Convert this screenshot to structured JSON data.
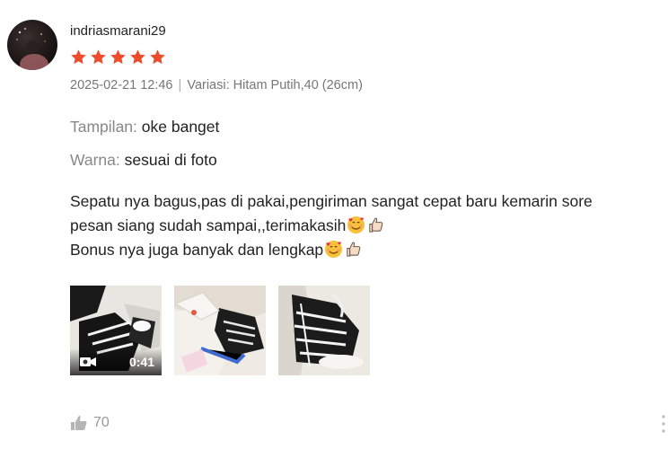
{
  "review": {
    "username": "indriasmarani29",
    "rating": 5,
    "timestamp": "2025-02-21 12:46",
    "separator": "|",
    "variation_label": "Variasi:",
    "variation_value": "Hitam Putih,40 (26cm)",
    "attributes": [
      {
        "key": "Tampilan:",
        "value": "oke banget"
      },
      {
        "key": "Warna:",
        "value": "sesuai di foto"
      }
    ],
    "comment_line1": "Sepatu nya bagus,pas di pakai,pengiriman sangat cepat baru kemarin sore",
    "comment_line2": "pesan siang sudah sampai,,terimakasih",
    "comment_line3": "Bonus nya juga banyak dan lengkap",
    "media": [
      {
        "type": "video",
        "duration": "0:41"
      },
      {
        "type": "image"
      },
      {
        "type": "image"
      }
    ],
    "like_count": "70",
    "colors": {
      "star": "#ee4d2d",
      "meta": "#777777",
      "like": "#999999"
    }
  }
}
